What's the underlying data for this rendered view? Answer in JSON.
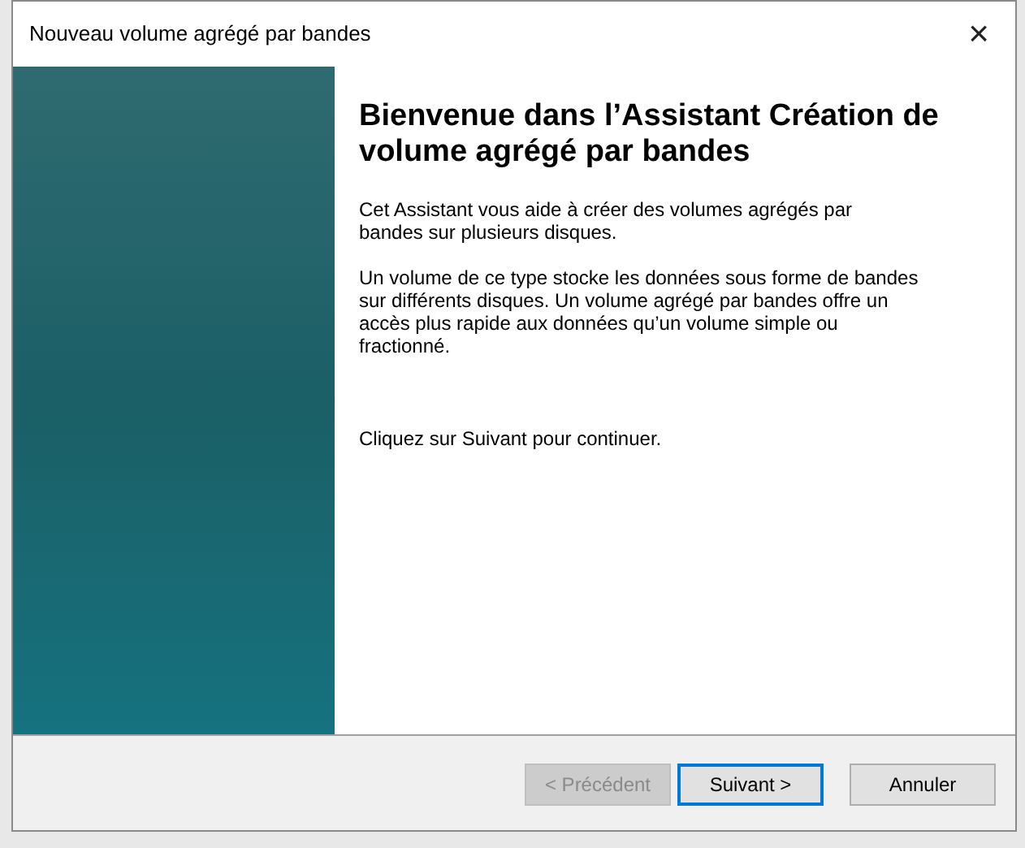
{
  "window": {
    "title": "Nouveau volume agrégé par bandes",
    "close": "×"
  },
  "heading": "Bienvenue dans l’Assistant Création de volume agrégé par bandes",
  "paragraphs": [
    "Cet Assistant vous aide à créer des volumes agrégés par bandes sur plusieurs disques.",
    "Un volume de ce type stocke les données sous forme de bandes sur différents disques. Un volume agrégé par bandes offre un accès plus rapide aux données qu’un volume simple ou fractionné."
  ],
  "instruction": "Cliquez sur Suivant pour continuer.",
  "buttons": [
    {
      "label": "< Précédent",
      "disabled": true,
      "default": false
    },
    {
      "label": "Suivant >",
      "disabled": false,
      "default": true
    },
    {
      "label": "Annuler",
      "disabled": false,
      "default": false
    }
  ]
}
